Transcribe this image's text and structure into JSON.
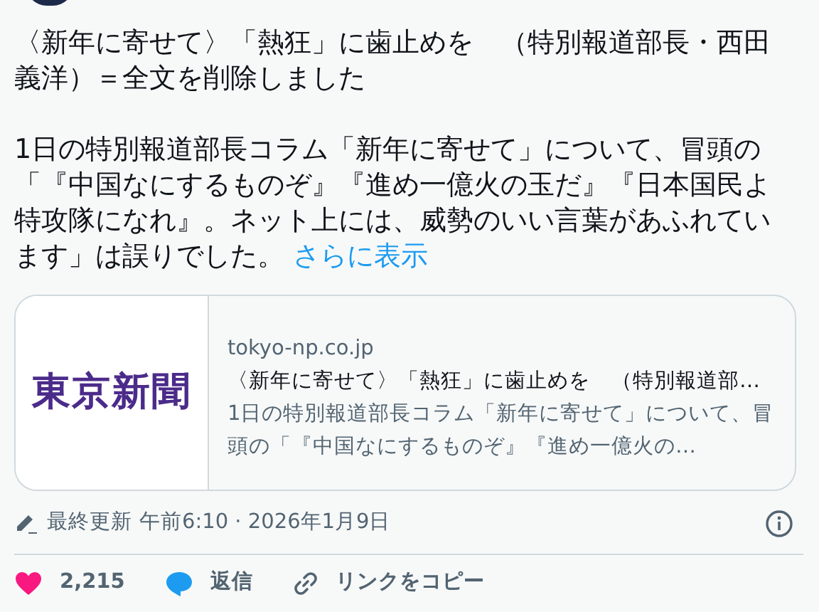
{
  "post": {
    "title": "〈新年に寄せて〉「熱狂」に歯止めを　（特別報道部長・西田義洋）＝全文を削除しました",
    "body": "1日の特別報道部長コラム「新年に寄せて」について、冒頭の「『中国なにするものぞ』『進め一億火の玉だ』『日本国民よ特攻隊になれ』。ネット上には、威勢のいい言葉があふれています」は誤りでした。",
    "show_more": "さらに表示"
  },
  "link_card": {
    "logo": "東京新聞",
    "domain": "tokyo-np.co.jp",
    "title": "〈新年に寄せて〉「熱狂」に歯止めを　（特別報道部…",
    "description": "1日の特別報道部長コラム「新年に寄せて」について、冒頭の「『中国なにするものぞ』『進め一億火の…"
  },
  "meta": {
    "edited_label": "最終更新",
    "timestamp": "午前6:10 · 2026年1月9日"
  },
  "actions": [
    {
      "kind": "like",
      "label": "2,215"
    },
    {
      "kind": "reply",
      "label": "返信"
    },
    {
      "kind": "copy_link",
      "label": "リンクをコピー"
    }
  ]
}
